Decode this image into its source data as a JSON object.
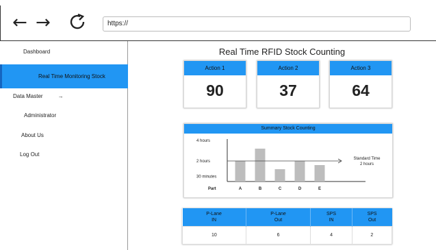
{
  "browser": {
    "back_icon": "left-arrow-icon",
    "forward_icon": "right-arrow-icon",
    "reload_icon": "reload-icon",
    "back_glyph": "←",
    "forward_glyph": "→",
    "reload_glyph": "⟳",
    "url": "https://"
  },
  "sidebar": {
    "items": [
      {
        "label": "Dashboard"
      },
      {
        "label": "Real Time Monitoring Stock",
        "active": true
      },
      {
        "label": "Data Master",
        "arrow": "→"
      },
      {
        "label": "Administrator"
      },
      {
        "label": "About Us"
      },
      {
        "label": "Log Out"
      }
    ]
  },
  "main": {
    "title": "Real Time RFID Stock Counting",
    "cards": [
      {
        "label": "Action 1",
        "value": "90"
      },
      {
        "label": "Action 2",
        "value": "37"
      },
      {
        "label": "Action 3",
        "value": "64"
      }
    ]
  },
  "chart_data": {
    "type": "bar",
    "title": "Summary Stock Counting",
    "xlabel": "Part",
    "categories": [
      "A",
      "B",
      "C",
      "D",
      "E"
    ],
    "values": [
      2.0,
      3.2,
      1.2,
      2.0,
      1.6
    ],
    "ylim": [
      0,
      4
    ],
    "y_ticks": [
      {
        "label": "4 hours",
        "value": 4
      },
      {
        "label": "2 hours",
        "value": 2
      },
      {
        "label": "30 minutes",
        "value": 0.5
      }
    ],
    "reference_line": {
      "value": 2,
      "label_line1": "Standard Time",
      "label_line2": "2 hours"
    },
    "bar_color": "#bdbdbd"
  },
  "table": {
    "headers": [
      [
        "P-Lane",
        "IN"
      ],
      [
        "P-Lane",
        "Out"
      ],
      [
        "SPS",
        "IN"
      ],
      [
        "SPS",
        "Out"
      ]
    ],
    "rows": [
      [
        "10",
        "6",
        "4",
        "2"
      ]
    ]
  },
  "colors": {
    "accent": "#2196f3"
  }
}
